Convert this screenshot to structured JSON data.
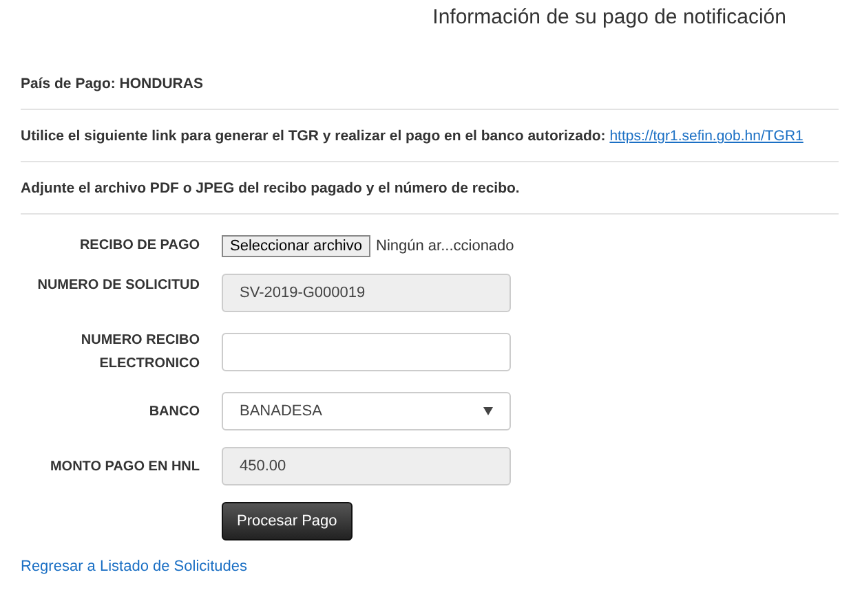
{
  "title": "Información de su pago de notificación",
  "info": [
    {
      "label": "País de Pago:",
      "value": "HONDURAS"
    },
    {
      "label": "Utilice el siguiente link para generar el TGR y realizar el pago en el banco autorizado:",
      "link": "https://tgr1.sefin.gob.hn/TGR1"
    },
    {
      "label": "Adjunte el archivo PDF o JPEG del recibo pagado y el número de recibo."
    }
  ],
  "fields": [
    {
      "kind": "file",
      "label": "RECIBO DE PAGO",
      "button": "Seleccionar archivo",
      "status": "Ningún ar...ccionado"
    },
    {
      "kind": "text",
      "label": "NUMERO DE SOLICITUD",
      "value": "SV-2019-G000019",
      "disabled": true
    },
    {
      "kind": "text",
      "label": "NUMERO RECIBO ELECTRONICO",
      "disabled": false
    },
    {
      "kind": "select",
      "label": "BANCO",
      "value": "BANADESA"
    },
    {
      "kind": "text",
      "label": "MONTO PAGO EN HNL",
      "value": "450.00",
      "disabled": true
    }
  ],
  "submit": "Procesar Pago",
  "back_link": "Regresar a Listado de Solicitudes"
}
